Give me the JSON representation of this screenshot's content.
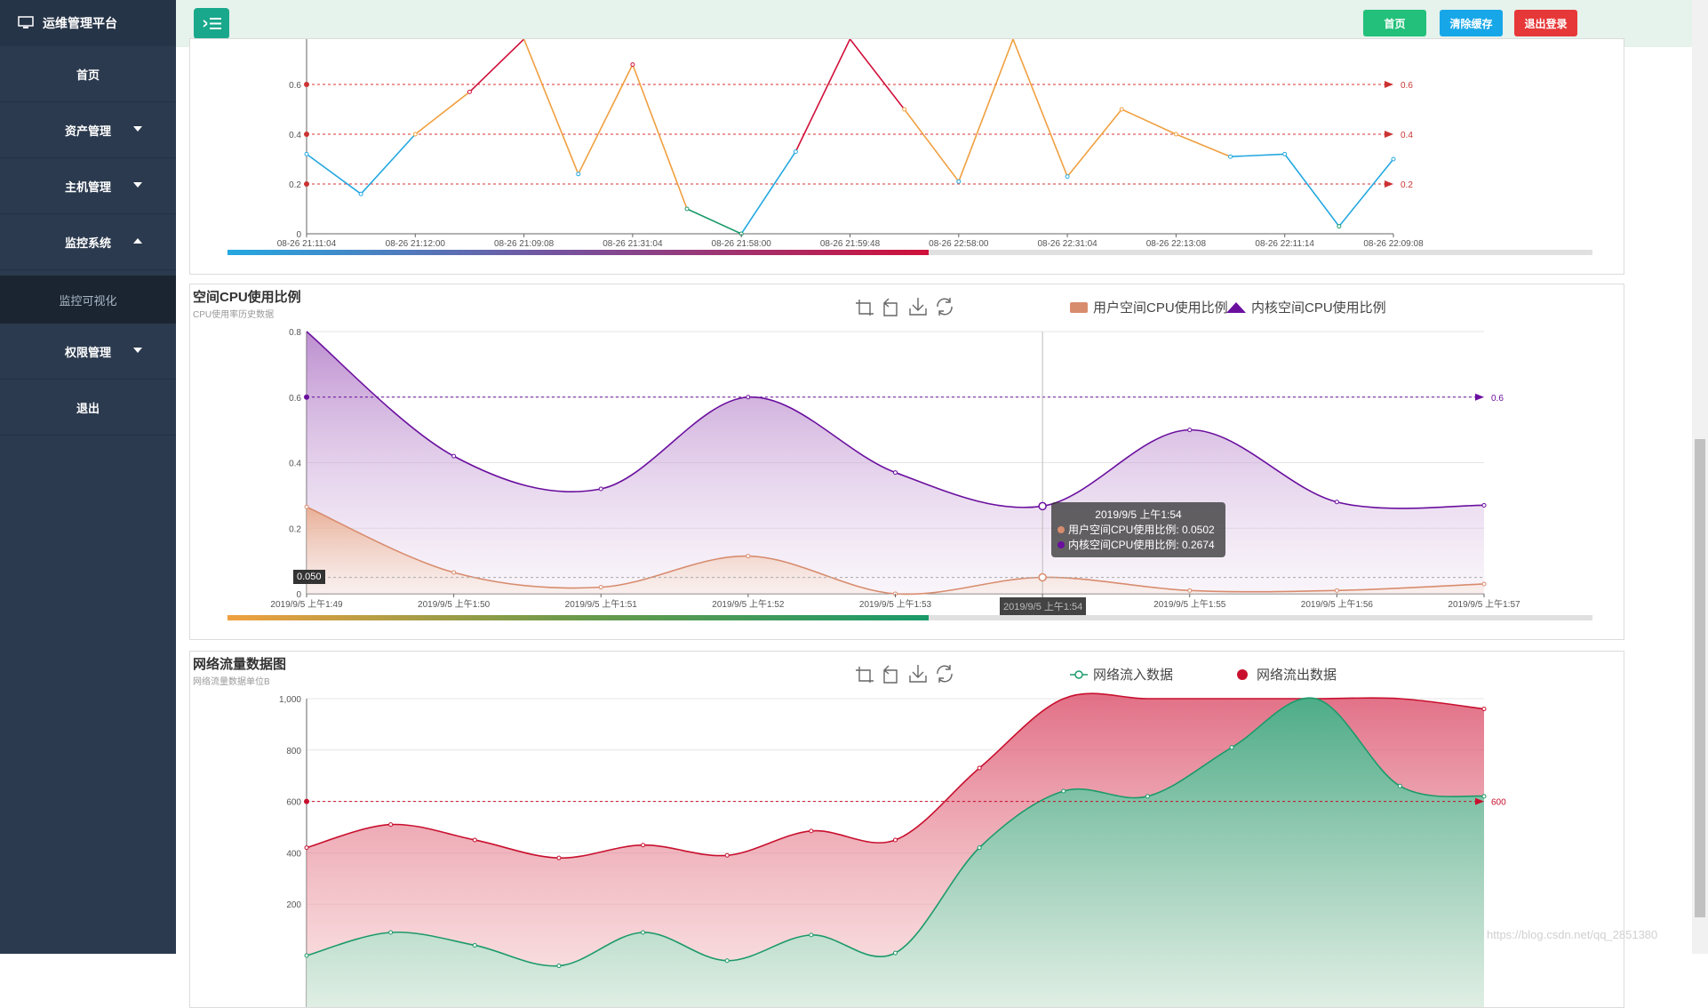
{
  "app": {
    "title": "运维管理平台"
  },
  "sidebar": {
    "items": [
      {
        "label": "首页"
      },
      {
        "label": "资产管理"
      },
      {
        "label": "主机管理"
      },
      {
        "label": "监控系统"
      },
      {
        "label": "监控可视化"
      },
      {
        "label": "权限管理"
      },
      {
        "label": "退出"
      }
    ]
  },
  "topbar": {
    "home_label": "首页",
    "clear_cache_label": "清除缓存",
    "logout_label": "退出登录"
  },
  "colors": {
    "green": "#22c07a",
    "blue": "#17a7e8",
    "red": "#e63838",
    "user_cpu": "#d88c6e",
    "kernel_cpu": "#6a0f9e",
    "net_in": "#1c9a6a",
    "net_out": "#c8102e"
  },
  "chart_data": [
    {
      "type": "line",
      "x": [
        "08-26 21:11:04",
        "08-26 21:12:00",
        "08-26 21:09:08",
        "08-26 21:31:04",
        "08-26 21:58:00",
        "08-26 21:59:48",
        "08-26 22:58:00",
        "08-26 22:31:04",
        "08-26 22:13:08",
        "08-26 22:11:14",
        "08-26 22:09:08"
      ],
      "series": [
        {
          "values": [
            0.32,
            0.16,
            0.4,
            0.57,
            0.8,
            0.24,
            0.68,
            0.1,
            0.0,
            0.33,
            0.8,
            0.5,
            0.21,
            0.8,
            0.23,
            0.5,
            0.4,
            0.31,
            0.32,
            0.03,
            0.3
          ]
        }
      ],
      "markline": {
        "values": [
          0.6,
          0.4,
          0.2
        ],
        "labels": [
          "0.6",
          "0.4",
          "0.2"
        ]
      },
      "y_ticks": [
        "0",
        "0.2",
        "0.4",
        "0.6"
      ],
      "ylim": [
        0,
        0.7
      ]
    },
    {
      "type": "area",
      "title": "空间CPU使用比例",
      "subtitle": "CPU使用率历史数据",
      "x": [
        "2019/9/5 上午1:49",
        "2019/9/5 上午1:50",
        "2019/9/5 上午1:51",
        "2019/9/5 上午1:52",
        "2019/9/5 上午1:53",
        "2019/9/5 上午1:54",
        "2019/9/5 上午1:55",
        "2019/9/5 上午1:56",
        "2019/9/5 上午1:57"
      ],
      "series": [
        {
          "name": "用户空间CPU使用比例",
          "values": [
            0.265,
            0.065,
            0.02,
            0.115,
            0.0,
            0.0502,
            0.01,
            0.01,
            0.03
          ]
        },
        {
          "name": "内核空间CPU使用比例",
          "values": [
            0.9,
            0.42,
            0.32,
            0.6,
            0.37,
            0.2674,
            0.5,
            0.28,
            0.27
          ]
        }
      ],
      "markline": {
        "value": 0.6,
        "label": "0.6"
      },
      "y_ticks": [
        "0",
        "0.2",
        "0.4",
        "0.6",
        "0.8"
      ],
      "ylim": [
        0,
        0.8
      ],
      "pointer_label": "0.050",
      "axis_pointer_x": "2019/9/5 上午1:54",
      "tooltip": {
        "title": "2019/9/5 上午1:54",
        "rows": [
          "用户空间CPU使用比例: 0.0502",
          "内核空间CPU使用比例: 0.2674"
        ]
      }
    },
    {
      "type": "area",
      "title": "网络流量数据图",
      "subtitle": "网络流量数据单位B",
      "series": [
        {
          "name": "网络流入数据",
          "values": [
            0,
            90,
            40,
            -40,
            90,
            -20,
            80,
            10,
            420,
            640,
            620,
            810,
            1050,
            660,
            620
          ]
        },
        {
          "name": "网络流出数据",
          "values": [
            420,
            510,
            450,
            380,
            430,
            390,
            485,
            450,
            730,
            1100,
            1100,
            1100,
            1100,
            1100,
            960
          ]
        }
      ],
      "markline": {
        "value": 600,
        "label": "600"
      },
      "y_ticks": [
        "200",
        "400",
        "600",
        "800",
        "1,000"
      ],
      "ylim": [
        0,
        1000
      ]
    }
  ],
  "watermark": "https://blog.csdn.net/qq_2851380"
}
